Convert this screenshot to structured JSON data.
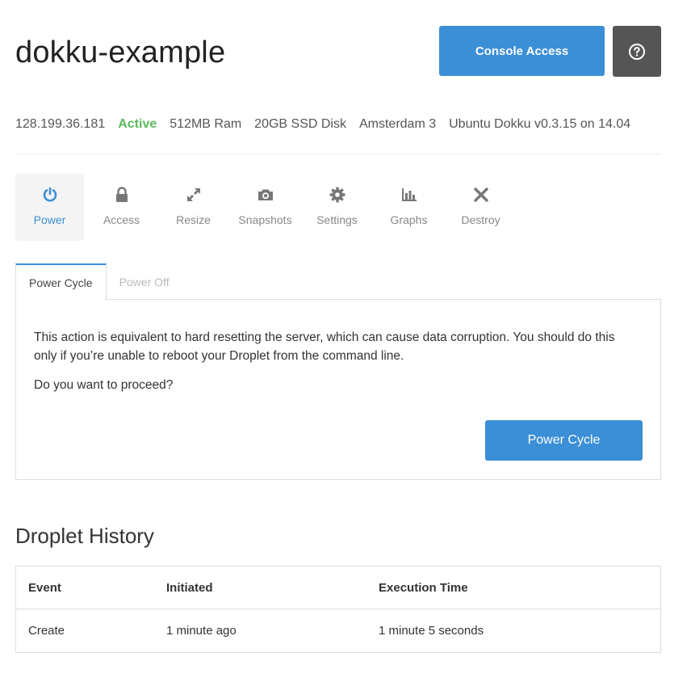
{
  "header": {
    "title": "dokku-example",
    "console_label": "Console Access",
    "help_icon": "question-circle-icon"
  },
  "meta": {
    "ip": "128.199.36.181",
    "status": "Active",
    "ram": "512MB Ram",
    "disk": "20GB SSD Disk",
    "region": "Amsterdam 3",
    "image": "Ubuntu Dokku v0.3.15 on 14.04",
    "status_color": "#5cb85c"
  },
  "nav": {
    "items": [
      {
        "label": "Power",
        "icon": "power-icon",
        "active": true
      },
      {
        "label": "Access",
        "icon": "lock-icon",
        "active": false
      },
      {
        "label": "Resize",
        "icon": "resize-icon",
        "active": false
      },
      {
        "label": "Snapshots",
        "icon": "camera-icon",
        "active": false
      },
      {
        "label": "Settings",
        "icon": "gear-icon",
        "active": false
      },
      {
        "label": "Graphs",
        "icon": "bar-chart-icon",
        "active": false
      },
      {
        "label": "Destroy",
        "icon": "close-icon",
        "active": false
      }
    ]
  },
  "tabs": [
    {
      "label": "Power Cycle",
      "active": true
    },
    {
      "label": "Power Off",
      "active": false
    }
  ],
  "panel": {
    "description": "This action is equivalent to hard resetting the server, which can cause data corruption. You should do this only if you’re unable to reboot your Droplet from the command line.",
    "question": "Do you want to proceed?",
    "button_label": "Power Cycle"
  },
  "history": {
    "title": "Droplet History",
    "columns": [
      "Event",
      "Initiated",
      "Execution Time"
    ],
    "rows": [
      [
        "Create",
        "1 minute ago",
        "1 minute 5 seconds"
      ]
    ]
  },
  "colors": {
    "accent": "#3b8fd7",
    "help_button": "#555555"
  }
}
